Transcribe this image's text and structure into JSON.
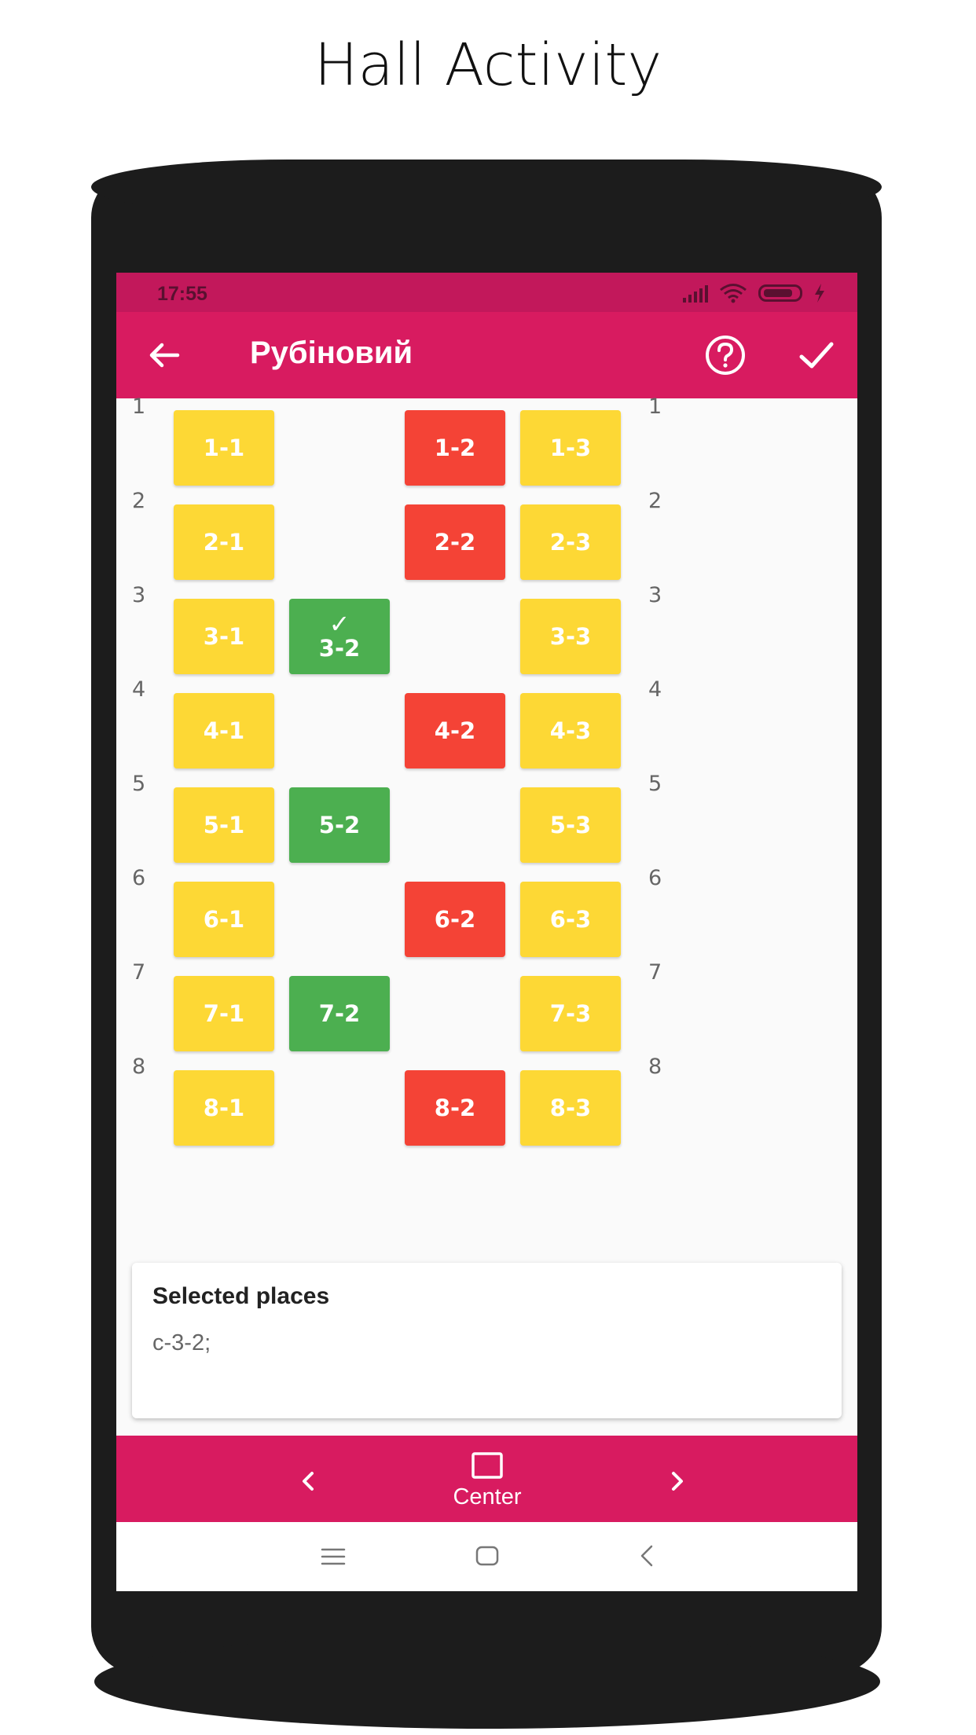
{
  "caption": "Hall Activity",
  "status_bar": {
    "time": "17:55",
    "icons": [
      "signal-icon",
      "wifi-icon",
      "battery-icon",
      "charging-icon"
    ]
  },
  "app_bar": {
    "title": "Рубіновий",
    "icons": [
      "back-arrow-icon",
      "help-icon",
      "check-icon"
    ]
  },
  "colors": {
    "app_bar": "#d81b60",
    "status_bar": "#c2185b",
    "available": "#fdd835",
    "occupied": "#f44336",
    "selected": "#4caf50"
  },
  "hall": {
    "rows": [
      {
        "number": "1",
        "seats": [
          {
            "label": "1-1",
            "status": "available"
          },
          {
            "label": "1-2",
            "status": "occupied"
          },
          {
            "label": "1-3",
            "status": "available"
          }
        ]
      },
      {
        "number": "2",
        "seats": [
          {
            "label": "2-1",
            "status": "available"
          },
          {
            "label": "2-2",
            "status": "occupied"
          },
          {
            "label": "2-3",
            "status": "available"
          }
        ]
      },
      {
        "number": "3",
        "seats": [
          {
            "label": "3-1",
            "status": "available"
          },
          {
            "label": "3-2",
            "status": "selected",
            "mark": "✓"
          },
          {
            "label": "3-3",
            "status": "available"
          }
        ]
      },
      {
        "number": "4",
        "seats": [
          {
            "label": "4-1",
            "status": "available"
          },
          {
            "label": "4-2",
            "status": "occupied"
          },
          {
            "label": "4-3",
            "status": "available"
          }
        ]
      },
      {
        "number": "5",
        "seats": [
          {
            "label": "5-1",
            "status": "available"
          },
          {
            "label": "5-2",
            "status": "selected"
          },
          {
            "label": "5-3",
            "status": "available"
          }
        ]
      },
      {
        "number": "6",
        "seats": [
          {
            "label": "6-1",
            "status": "available"
          },
          {
            "label": "6-2",
            "status": "occupied"
          },
          {
            "label": "6-3",
            "status": "available"
          }
        ]
      },
      {
        "number": "7",
        "seats": [
          {
            "label": "7-1",
            "status": "available"
          },
          {
            "label": "7-2",
            "status": "selected"
          },
          {
            "label": "7-3",
            "status": "available"
          }
        ]
      },
      {
        "number": "8",
        "seats": [
          {
            "label": "8-1",
            "status": "available"
          },
          {
            "label": "8-2",
            "status": "occupied"
          },
          {
            "label": "8-3",
            "status": "available"
          }
        ]
      }
    ]
  },
  "selected_card": {
    "title": "Selected places",
    "value": "c-3-2;"
  },
  "bottom_bar": {
    "center_label": "Center",
    "icons": [
      "chevron-left-icon",
      "square-icon",
      "chevron-right-icon"
    ]
  },
  "nav_bar": {
    "icons": [
      "menu-icon",
      "home-icon",
      "back-icon"
    ]
  }
}
